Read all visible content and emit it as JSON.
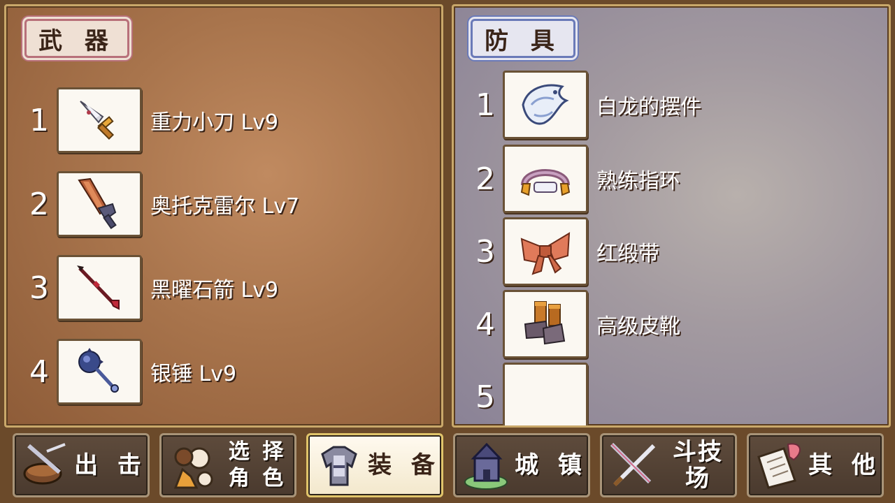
{
  "weapons_panel": {
    "title": "武 器",
    "items": [
      {
        "num": "1",
        "name": "重力小刀 Lv9",
        "icon": "dagger-icon"
      },
      {
        "num": "2",
        "name": "奥托克雷尔 Lv7",
        "icon": "sword-icon"
      },
      {
        "num": "3",
        "name": "黑曜石箭 Lv9",
        "icon": "arrow-icon"
      },
      {
        "num": "4",
        "name": "银锤 Lv9",
        "icon": "mace-icon"
      }
    ]
  },
  "armor_panel": {
    "title": "防 具",
    "items": [
      {
        "num": "1",
        "name": "白龙的摆件",
        "icon": "white-dragon-icon"
      },
      {
        "num": "2",
        "name": "熟练指环",
        "icon": "ring-icon"
      },
      {
        "num": "3",
        "name": "红缎带",
        "icon": "ribbon-icon"
      },
      {
        "num": "4",
        "name": "高级皮靴",
        "icon": "boots-icon"
      },
      {
        "num": "5",
        "name": "",
        "icon": ""
      }
    ]
  },
  "nav": {
    "sortie": "出 击",
    "select_char_1": "选 择",
    "select_char_2": "角 色",
    "equip": "装 备",
    "town": "城 镇",
    "arena": "斗技场",
    "other": "其 他"
  },
  "colors": {
    "weapon_tag_border": "#b8707a",
    "armor_tag_border": "#6a7ab8",
    "active_tab_border": "#e0c46a"
  }
}
